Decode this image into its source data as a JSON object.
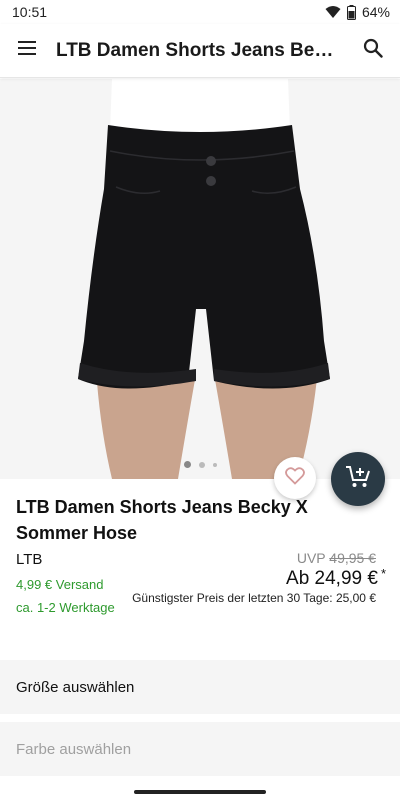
{
  "status_bar": {
    "time": "10:51",
    "battery": "64%",
    "icons": [
      "wifi-icon",
      "battery-icon"
    ]
  },
  "app_bar": {
    "title": "LTB Damen Shorts Jeans Be…",
    "menu_icon": "hamburger-menu-icon",
    "search_icon": "search-icon"
  },
  "gallery": {
    "image_subject": "black denim shorts",
    "dot_count": 3,
    "active_dot": 0
  },
  "product": {
    "title": "LTB Damen Shorts Jeans Becky X Sommer Hose",
    "brand": "LTB",
    "shipping_line1": "4,99 € Versand",
    "shipping_line2": "ca. 1-2 Werktage",
    "uvp_label": "UVP",
    "uvp_price": "49,95 €",
    "price": "Ab 24,99 €",
    "price_mark": "*",
    "lowest_price_note": "Günstigster Preis der letzten 30 Tage: 25,00 €"
  },
  "selections": {
    "size_label": "Größe auswählen",
    "color_label": "Farbe auswählen"
  },
  "colors": {
    "accent_dark": "#2a3a45",
    "shipping_green": "#2e9a2e",
    "wishlist_heart": "#d49a9a"
  }
}
